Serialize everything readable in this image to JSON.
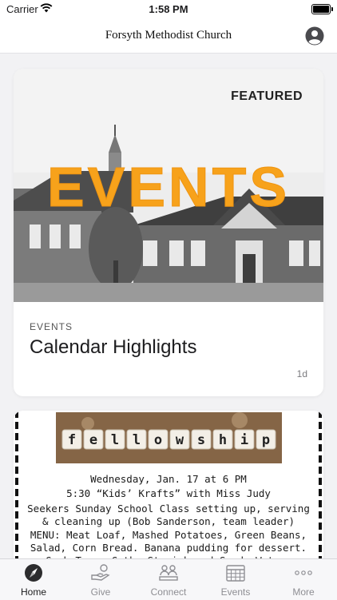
{
  "status_bar": {
    "carrier": "Carrier",
    "time": "1:58 PM"
  },
  "header": {
    "title": "Forsyth Methodist Church"
  },
  "featured_card": {
    "badge": "FEATURED",
    "image_text": "EVENTS",
    "category": "EVENTS",
    "title": "Calendar Highlights",
    "age": "1d"
  },
  "fellowship_card": {
    "banner_word": "fellowship",
    "lines": [
      "Wednesday, Jan. 17 at 6 PM",
      "5:30 “Kids’ Krafts” with Miss Judy",
      "Seekers Sunday School Class setting up, serving",
      "& cleaning up (Bob Sanderson, team leader)",
      "MENU: Meat Loaf, Mashed Potatoes, Green Beans,",
      "Salad, Corn Bread. Banana pudding for dessert.",
      "Cook Team: Cathy Stevick and Sandy Watson"
    ]
  },
  "tabs": [
    {
      "label": "Home",
      "icon": "compass-icon",
      "active": true
    },
    {
      "label": "Give",
      "icon": "give-hand-icon",
      "active": false
    },
    {
      "label": "Connect",
      "icon": "connect-people-icon",
      "active": false
    },
    {
      "label": "Events",
      "icon": "calendar-icon",
      "active": false
    },
    {
      "label": "More",
      "icon": "more-dots-icon",
      "active": false
    }
  ],
  "colors": {
    "events_orange": "#f7a21b",
    "tab_inactive": "#8e8e93"
  }
}
